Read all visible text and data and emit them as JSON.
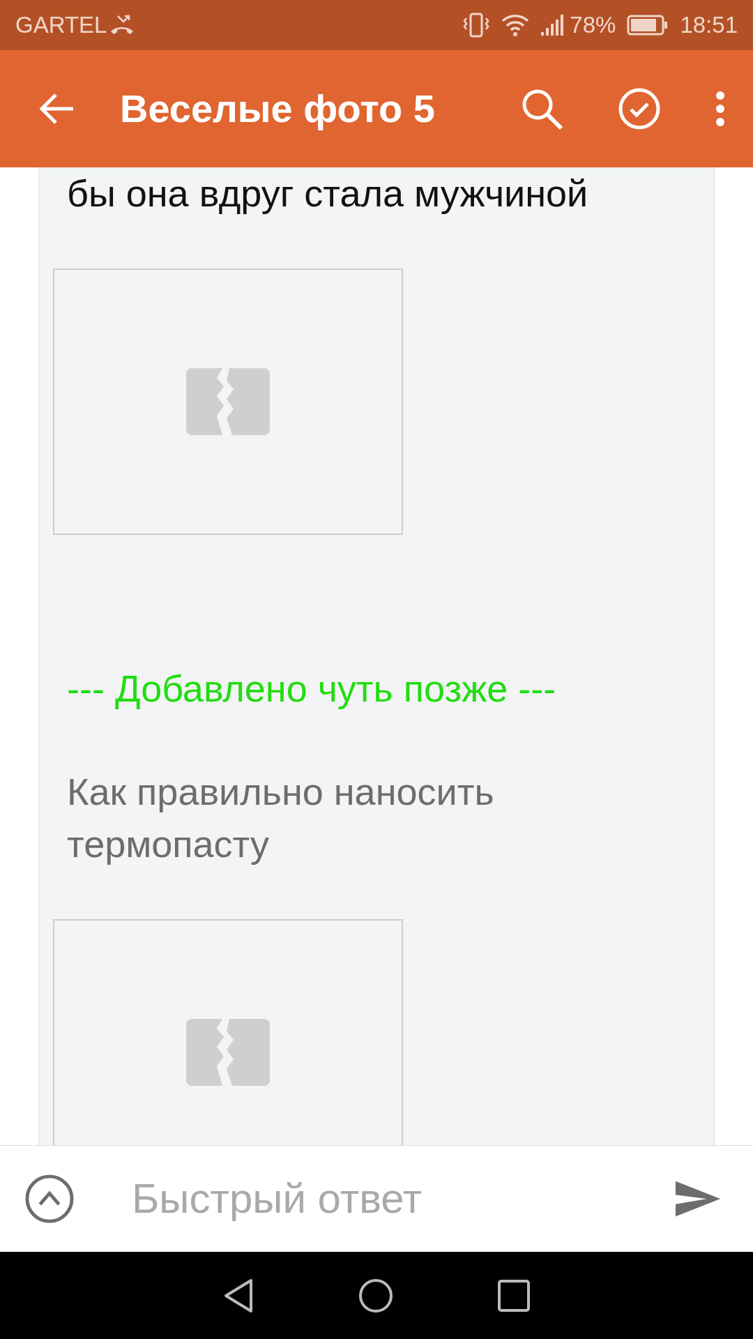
{
  "status_bar": {
    "carrier": "GARTEL",
    "battery": "78%",
    "time": "18:51"
  },
  "app_bar": {
    "title": "Веселые фото 5"
  },
  "post": [
    {
      "kind": "text",
      "text": "бы она вдруг стала мужчиной",
      "muted": false
    },
    {
      "kind": "image"
    },
    {
      "kind": "note",
      "text": "--- Добавлено чуть позже ---"
    },
    {
      "kind": "text",
      "text": "Как правильно наносить термопасту",
      "muted": true
    },
    {
      "kind": "image"
    }
  ],
  "reply_bar": {
    "placeholder": "Быстрый ответ"
  }
}
